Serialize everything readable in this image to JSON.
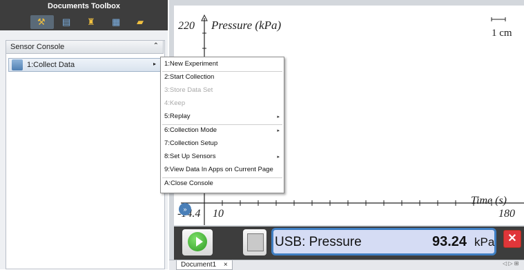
{
  "toolbox": {
    "title": "Documents Toolbox",
    "tabs": [
      {
        "icon": "tools-icon",
        "glyph": "⚒"
      },
      {
        "icon": "pages-icon",
        "glyph": "▤"
      },
      {
        "icon": "probe-icon",
        "glyph": "♜"
      },
      {
        "icon": "library-icon",
        "glyph": "▦"
      },
      {
        "icon": "folder-icon",
        "glyph": "▰"
      }
    ],
    "section_title": "Sensor Console",
    "collapse_glyph": "⌃",
    "collect_item": "1:Collect Data",
    "collect_arrow": "▸"
  },
  "menu": {
    "items": [
      {
        "label": "1:New Experiment",
        "enabled": true,
        "submenu": false
      },
      {
        "label": "2:Start Collection",
        "enabled": true,
        "submenu": false
      },
      {
        "label": "3:Store Data Set",
        "enabled": false,
        "submenu": false
      },
      {
        "label": "4:Keep",
        "enabled": false,
        "submenu": false
      },
      {
        "label": "5:Replay",
        "enabled": true,
        "submenu": true
      },
      {
        "label": "6:Collection Mode",
        "enabled": true,
        "submenu": true
      },
      {
        "label": "7:Collection Setup",
        "enabled": true,
        "submenu": false
      },
      {
        "label": "8:Set Up Sensors",
        "enabled": true,
        "submenu": true
      },
      {
        "label": "9:View Data In Apps on Current Page",
        "enabled": true,
        "submenu": false
      },
      {
        "label": "A:Close Console",
        "enabled": true,
        "submenu": false
      }
    ],
    "submenu_arrow": "▸"
  },
  "graph": {
    "ymax": "220",
    "ylabel": "Pressure (kPa)",
    "scale": "1 cm",
    "xlabel": "Time (s)",
    "xmin": "-14.4",
    "xtick": "10",
    "xmax": "180",
    "expand_glyph": "»"
  },
  "meter": {
    "sensor": "USB: Pressure",
    "value": "93.24",
    "unit": "kPa",
    "close_glyph": "✕"
  },
  "document": {
    "tab": "Document1",
    "close": "×",
    "nav": "◁ ▷ ⊞"
  }
}
